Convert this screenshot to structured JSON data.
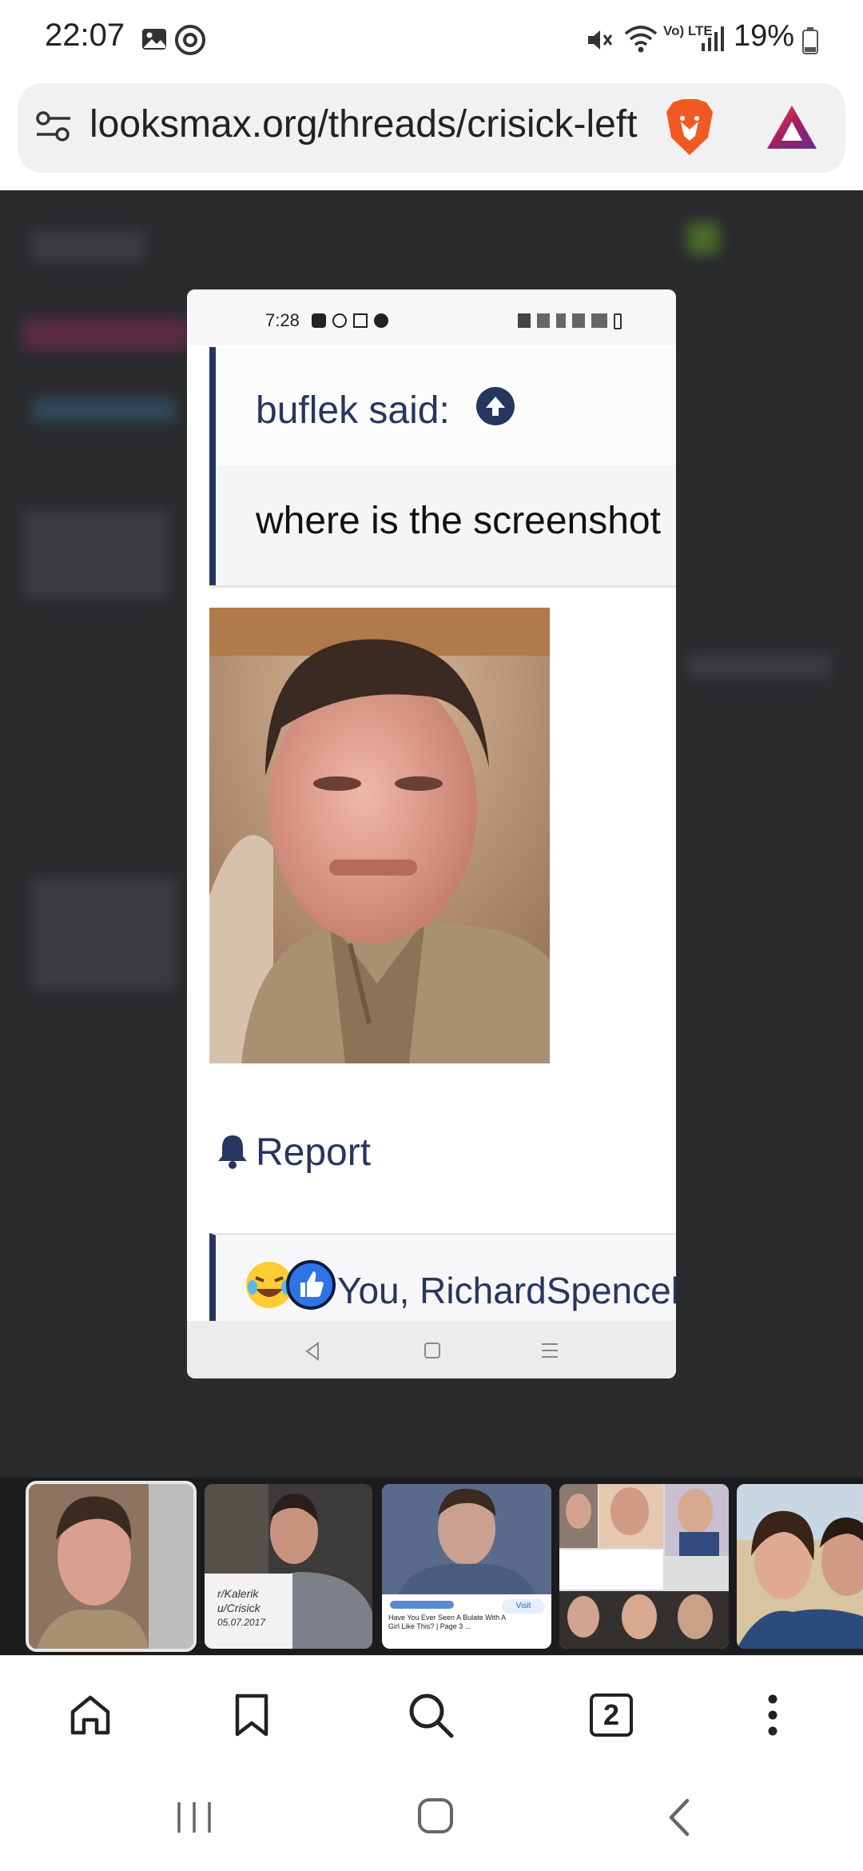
{
  "status_bar": {
    "time": "22:07",
    "battery": "19%",
    "network": "Vo) LTE"
  },
  "browser": {
    "url": "looksmax.org/threads/crisick-left",
    "open_tabs": "2"
  },
  "card": {
    "status_time": "7:28",
    "quote_author": "buflek said:",
    "quote_text": "where is the screenshot",
    "report_label": "Report",
    "reactions_text": "You, RichardSpencel"
  },
  "thumbnails": {
    "note_line1": "r/Kalerik",
    "note_line2": "u/Crisick",
    "note_line3": "05.07.2017",
    "ad_title": "Have You Ever Seen A Bulate With A Girl Like This? | Page 3 ...",
    "ad_button": "Visit"
  },
  "colors": {
    "accent_navy": "#27365f",
    "dark_bg": "#2a2b2d"
  }
}
